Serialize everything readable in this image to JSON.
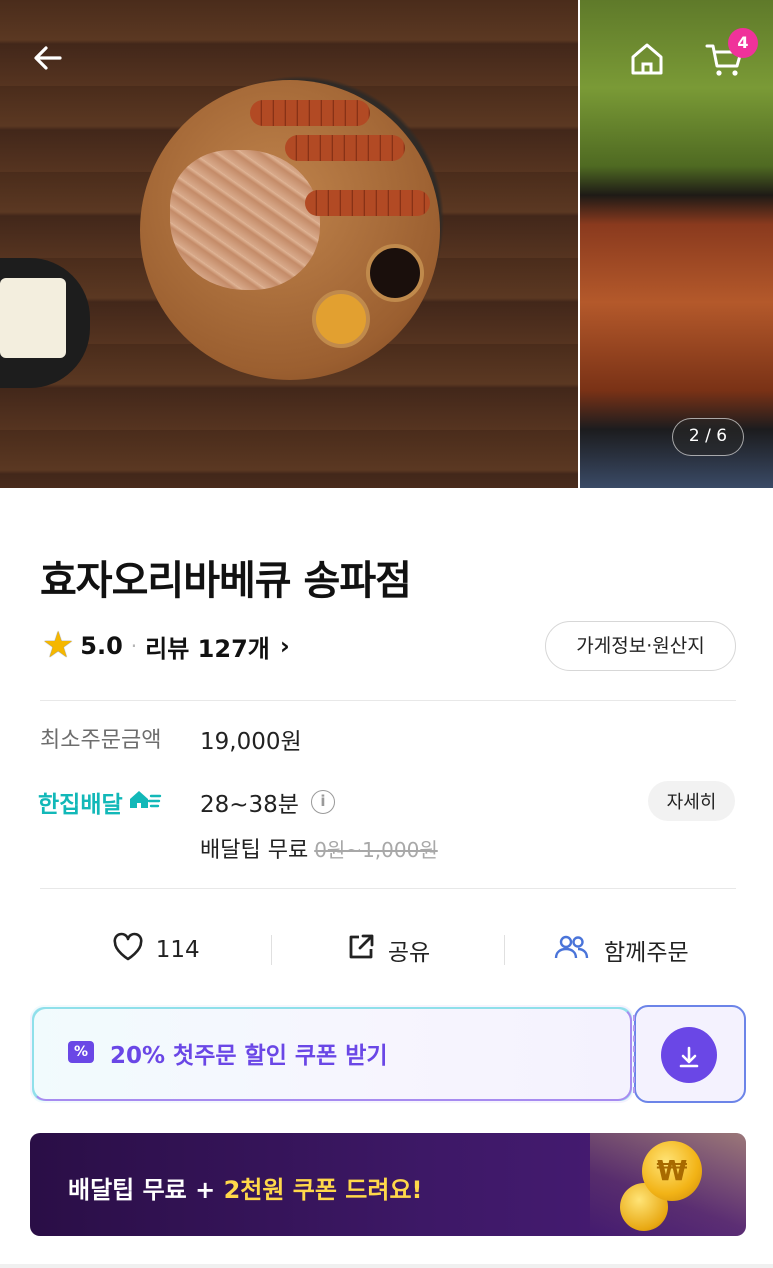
{
  "hero": {
    "page_indicator": "2 / 6",
    "cart_count": "4"
  },
  "store": {
    "name": "효자오리바베큐 송파점",
    "rating": "5.0",
    "review_label": "리뷰 127개",
    "info_button": "가게정보·원산지"
  },
  "order": {
    "min_order_label": "최소주문금액",
    "min_order_value": "19,000원",
    "delivery_brand": "한집배달",
    "delivery_time": "28~38분",
    "detail_button": "자세히",
    "tip_label": "배달팁 무료",
    "tip_old": "0원~1,000원"
  },
  "actions": {
    "likes": "114",
    "share": "공유",
    "group_order": "함께주문"
  },
  "coupon": {
    "text": "20% 첫주문 할인 쿠폰 받기"
  },
  "banner": {
    "text_part1": "배달팁 무료 + ",
    "text_highlight": "2천원 쿠폰 드려요!"
  },
  "icons": [
    "back-icon",
    "home-icon",
    "cart-icon",
    "star-icon",
    "chevron-right-icon",
    "house-icon",
    "info-icon",
    "heart-icon",
    "share-icon",
    "users-icon",
    "coupon-icon",
    "download-icon",
    "coin-icon"
  ],
  "colors": {
    "accent_purple": "#6a47e6",
    "delivery_teal": "#12b8b8",
    "badge_pink": "#f0329a",
    "banner_bg": "#2a0e46",
    "banner_highlight": "#ffd84a",
    "star": "#f5b700"
  }
}
